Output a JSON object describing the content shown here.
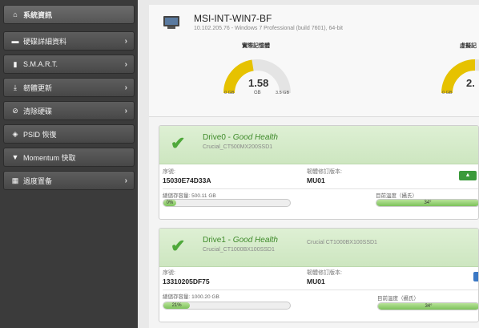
{
  "sidebar": {
    "items": [
      {
        "icon": "home-icon",
        "glyph": "⌂",
        "label": "系統資訊",
        "chevron": ""
      },
      {
        "icon": "drive-icon",
        "glyph": "▬",
        "label": "硬碟詳細資料",
        "chevron": "›"
      },
      {
        "icon": "chart-icon",
        "glyph": "▮",
        "label": "S.M.A.R.T.",
        "chevron": "›"
      },
      {
        "icon": "download-icon",
        "glyph": "⤓",
        "label": "韌體更新",
        "chevron": "›"
      },
      {
        "icon": "erase-icon",
        "glyph": "⊘",
        "label": "清除硬碟",
        "chevron": "›"
      },
      {
        "icon": "psid-icon",
        "glyph": "◈",
        "label": "PSID 恢復",
        "chevron": ""
      },
      {
        "icon": "funnel-icon",
        "glyph": "▼",
        "label": "Momentum 快取",
        "chevron": ""
      },
      {
        "icon": "grid-icon",
        "glyph": "▦",
        "label": "過度置备",
        "chevron": "›"
      }
    ]
  },
  "system": {
    "hostname": "MSI-INT-WIN7-BF",
    "subtitle": "10.102.205.76 - Windows 7 Professional (build 7601), 64-bit"
  },
  "gauges": [
    {
      "title": "實際記憶體",
      "value": "1.58",
      "unit": "GB",
      "min": "0 GB",
      "max": "3.5 GB",
      "fraction": 0.45
    },
    {
      "title": "虛擬記",
      "value": "2.",
      "unit": "",
      "min": "0 GB",
      "max": "",
      "fraction": 0.5
    }
  ],
  "drives": [
    {
      "name": "Drive0",
      "health": "Good Health",
      "model": "Crucial_CT500MX200SSD1",
      "model_right": "",
      "serial_label": "序號:",
      "serial": "15030E74D33A",
      "fw_label": "韌體修訂版本:",
      "fw": "MU01",
      "capacity_label": "總儲存容量:",
      "capacity": "500.11 GB",
      "used_pct": 0.08,
      "used_text": "0%",
      "temp_label": "目前溫度（攝氏）",
      "temp_text": "34°",
      "temp_pct": 1.0,
      "button_color": "#3a9a3a",
      "button_glyph": "▲"
    },
    {
      "name": "Drive1",
      "health": "Good Health",
      "model": "Crucial_CT1000BX100SSD1",
      "model_right": "Crucial  CT1000BX100SSD1",
      "serial_label": "序號:",
      "serial": "13310205DF75",
      "fw_label": "韌體修訂版本:",
      "fw": "MU01",
      "capacity_label": "總儲存容量:",
      "capacity": "1000.20 GB",
      "used_pct": 0.21,
      "used_text": "21%",
      "temp_label": "目前溫度（攝氏）",
      "temp_text": "34°",
      "temp_pct": 1.0,
      "button_color": "#3b78c4",
      "button_glyph": "✎"
    }
  ]
}
